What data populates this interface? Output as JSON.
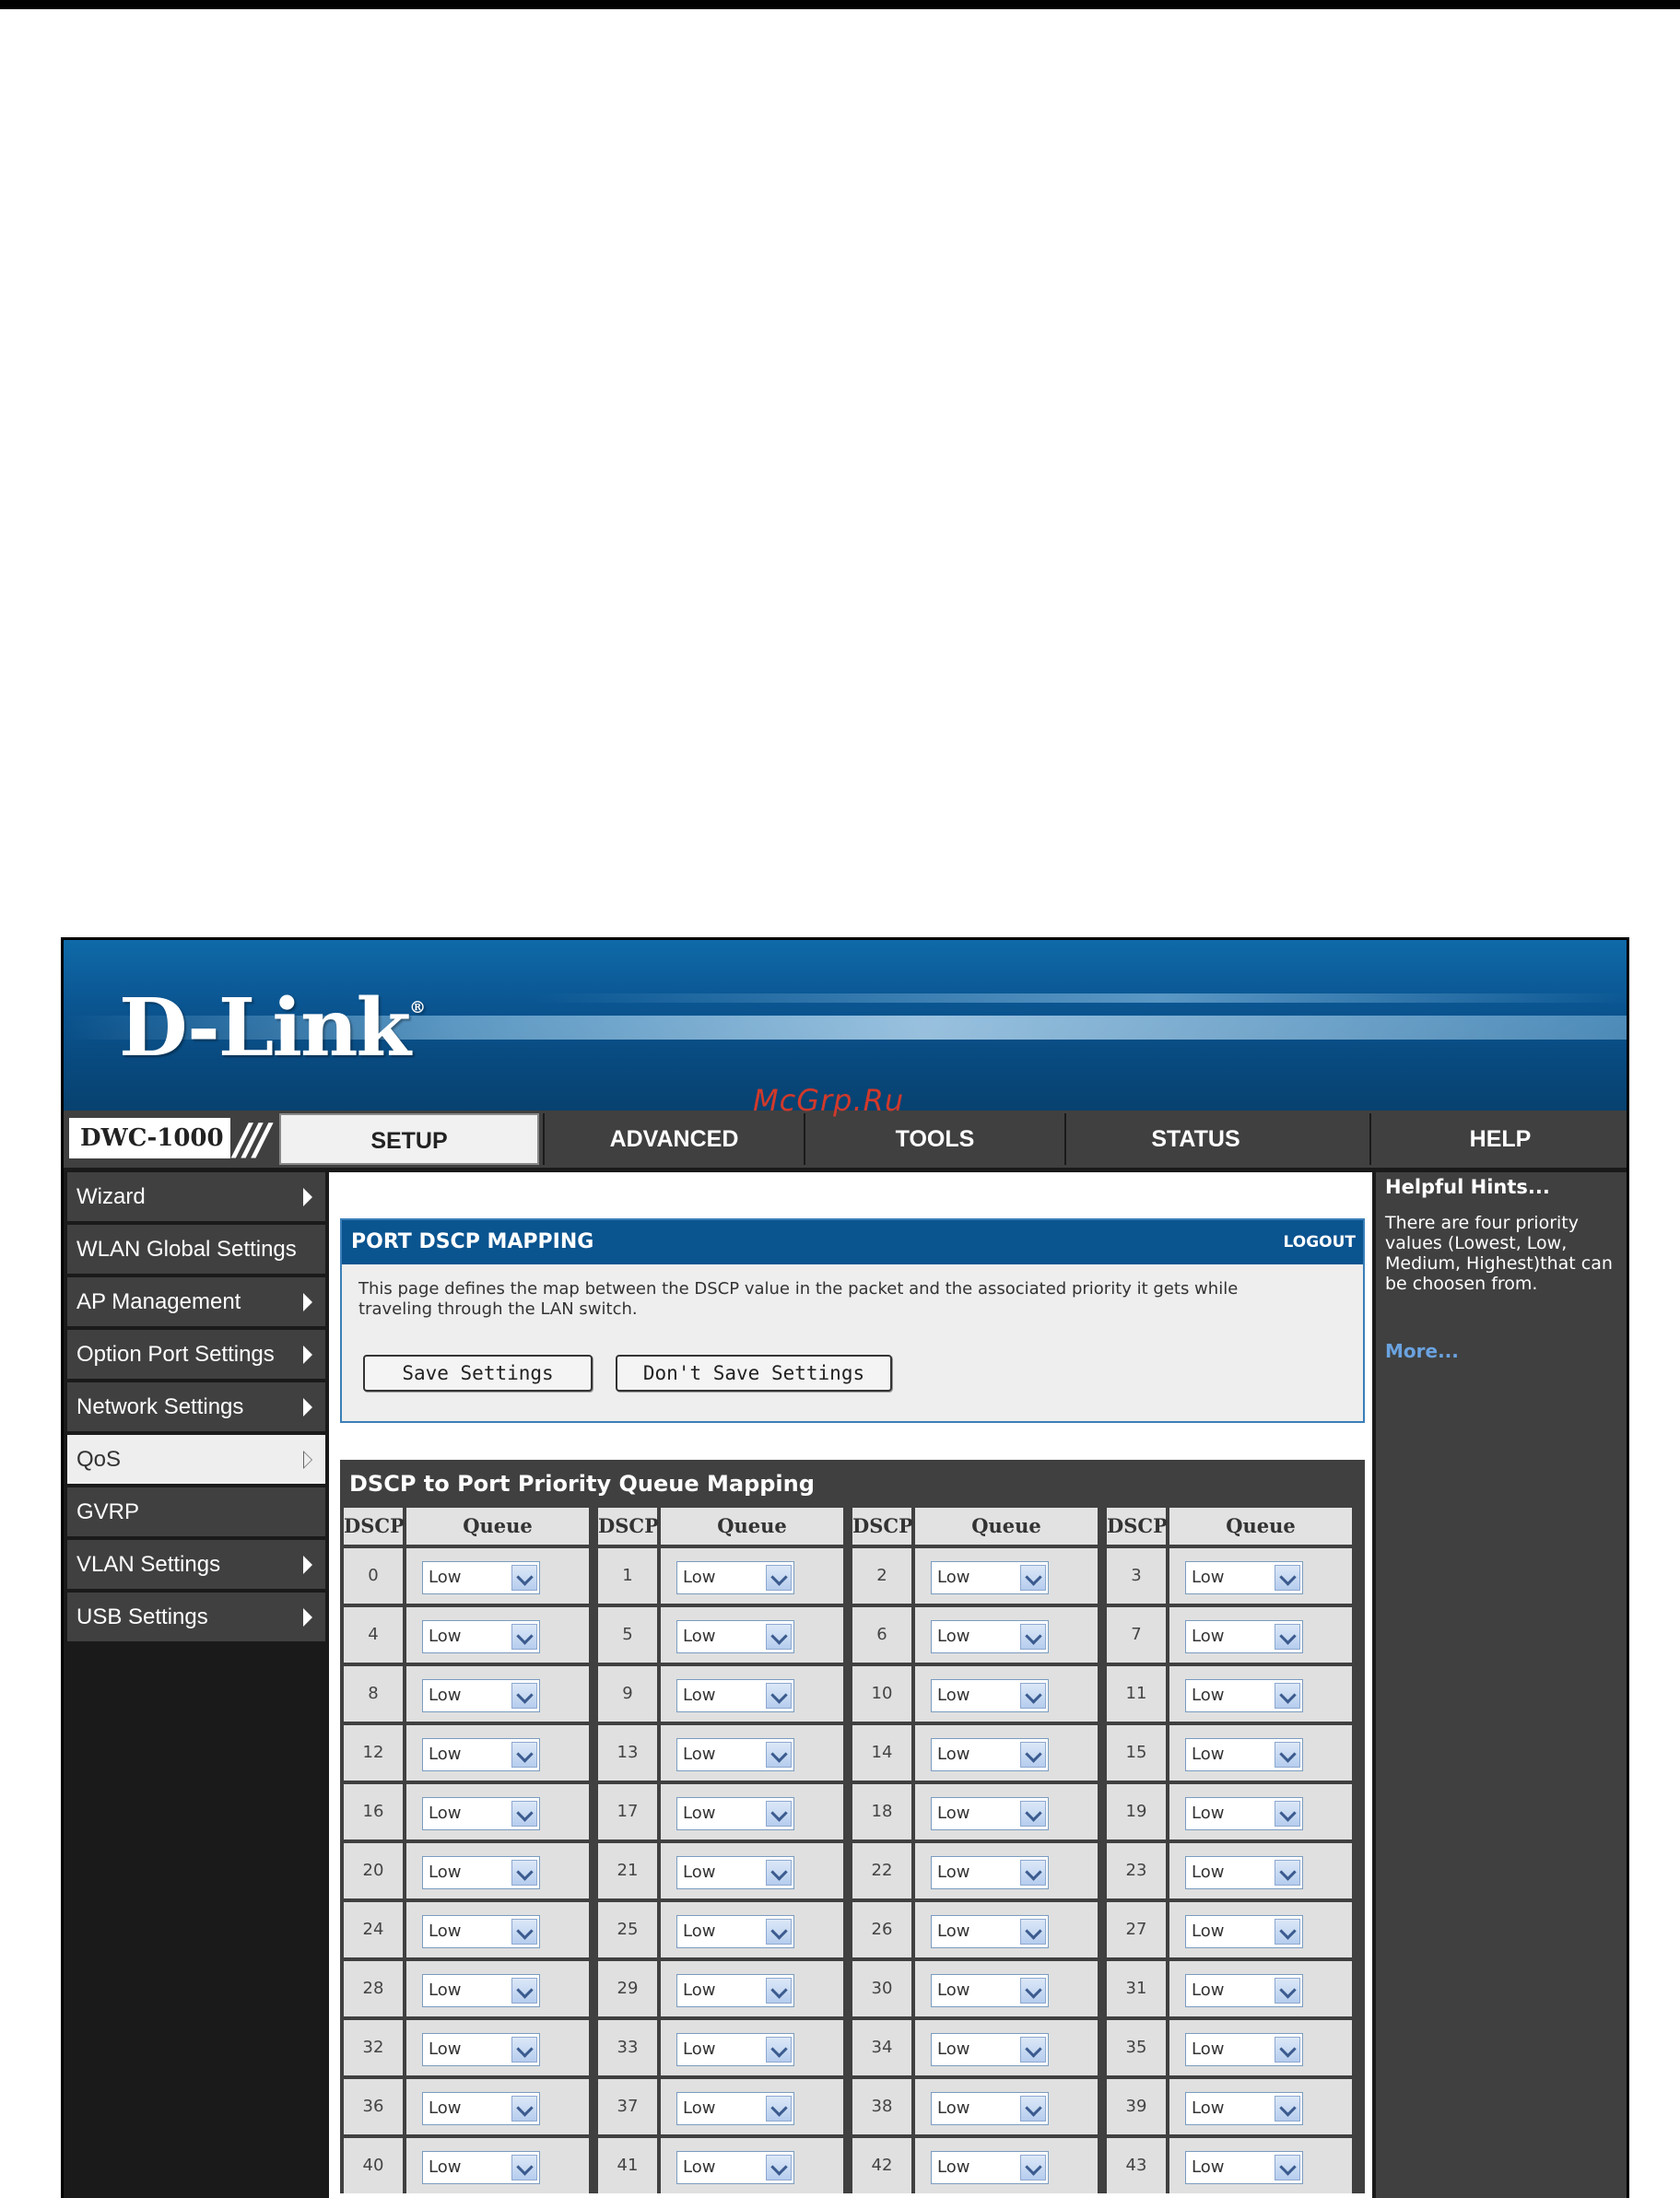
{
  "brand": {
    "logo_text": "D-Link",
    "logo_mark": "®",
    "model": "DWC-1000",
    "slashes": "///"
  },
  "watermark": "McGrp.Ru",
  "nav": {
    "tabs": [
      {
        "label": "SETUP"
      },
      {
        "label": "ADVANCED"
      },
      {
        "label": "TOOLS"
      },
      {
        "label": "STATUS"
      },
      {
        "label": "HELP"
      }
    ]
  },
  "sidebar": {
    "items": [
      {
        "label": "Wizard"
      },
      {
        "label": "WLAN Global Settings"
      },
      {
        "label": "AP Management"
      },
      {
        "label": "Option Port Settings"
      },
      {
        "label": "Network Settings"
      },
      {
        "label": "QoS"
      },
      {
        "label": "GVRP"
      },
      {
        "label": "VLAN Settings"
      },
      {
        "label": "USB Settings"
      }
    ]
  },
  "panel": {
    "title": "PORT DSCP MAPPING",
    "logout": "LOGOUT",
    "description": "This page defines the map between the DSCP value in the packet and the associated priority it gets while traveling through the LAN switch.",
    "save_label": "Save Settings",
    "dont_save_label": "Don't Save Settings"
  },
  "table": {
    "title": "DSCP to Port Priority Queue Mapping",
    "headers": [
      "DSCP",
      "Queue",
      "DSCP",
      "Queue",
      "DSCP",
      "Queue",
      "DSCP",
      "Queue"
    ],
    "rows": [
      [
        {
          "dscp": "0",
          "queue": "Low"
        },
        {
          "dscp": "1",
          "queue": "Low"
        },
        {
          "dscp": "2",
          "queue": "Low"
        },
        {
          "dscp": "3",
          "queue": "Low"
        }
      ],
      [
        {
          "dscp": "4",
          "queue": "Low"
        },
        {
          "dscp": "5",
          "queue": "Low"
        },
        {
          "dscp": "6",
          "queue": "Low"
        },
        {
          "dscp": "7",
          "queue": "Low"
        }
      ],
      [
        {
          "dscp": "8",
          "queue": "Low"
        },
        {
          "dscp": "9",
          "queue": "Low"
        },
        {
          "dscp": "10",
          "queue": "Low"
        },
        {
          "dscp": "11",
          "queue": "Low"
        }
      ],
      [
        {
          "dscp": "12",
          "queue": "Low"
        },
        {
          "dscp": "13",
          "queue": "Low"
        },
        {
          "dscp": "14",
          "queue": "Low"
        },
        {
          "dscp": "15",
          "queue": "Low"
        }
      ],
      [
        {
          "dscp": "16",
          "queue": "Low"
        },
        {
          "dscp": "17",
          "queue": "Low"
        },
        {
          "dscp": "18",
          "queue": "Low"
        },
        {
          "dscp": "19",
          "queue": "Low"
        }
      ],
      [
        {
          "dscp": "20",
          "queue": "Low"
        },
        {
          "dscp": "21",
          "queue": "Low"
        },
        {
          "dscp": "22",
          "queue": "Low"
        },
        {
          "dscp": "23",
          "queue": "Low"
        }
      ],
      [
        {
          "dscp": "24",
          "queue": "Low"
        },
        {
          "dscp": "25",
          "queue": "Low"
        },
        {
          "dscp": "26",
          "queue": "Low"
        },
        {
          "dscp": "27",
          "queue": "Low"
        }
      ],
      [
        {
          "dscp": "28",
          "queue": "Low"
        },
        {
          "dscp": "29",
          "queue": "Low"
        },
        {
          "dscp": "30",
          "queue": "Low"
        },
        {
          "dscp": "31",
          "queue": "Low"
        }
      ],
      [
        {
          "dscp": "32",
          "queue": "Low"
        },
        {
          "dscp": "33",
          "queue": "Low"
        },
        {
          "dscp": "34",
          "queue": "Low"
        },
        {
          "dscp": "35",
          "queue": "Low"
        }
      ],
      [
        {
          "dscp": "36",
          "queue": "Low"
        },
        {
          "dscp": "37",
          "queue": "Low"
        },
        {
          "dscp": "38",
          "queue": "Low"
        },
        {
          "dscp": "39",
          "queue": "Low"
        }
      ],
      [
        {
          "dscp": "40",
          "queue": "Low"
        },
        {
          "dscp": "41",
          "queue": "Low"
        },
        {
          "dscp": "42",
          "queue": "Low"
        },
        {
          "dscp": "43",
          "queue": "Low"
        }
      ]
    ]
  },
  "help": {
    "title": "Helpful Hints...",
    "text": "There are four priority values (Lowest, Low, Medium, Highest)that can be choosen from.",
    "more": "More..."
  },
  "colors": {
    "brand_blue": "#0a5490",
    "nav_gray": "#404040",
    "link_blue": "#6aa3e0"
  }
}
